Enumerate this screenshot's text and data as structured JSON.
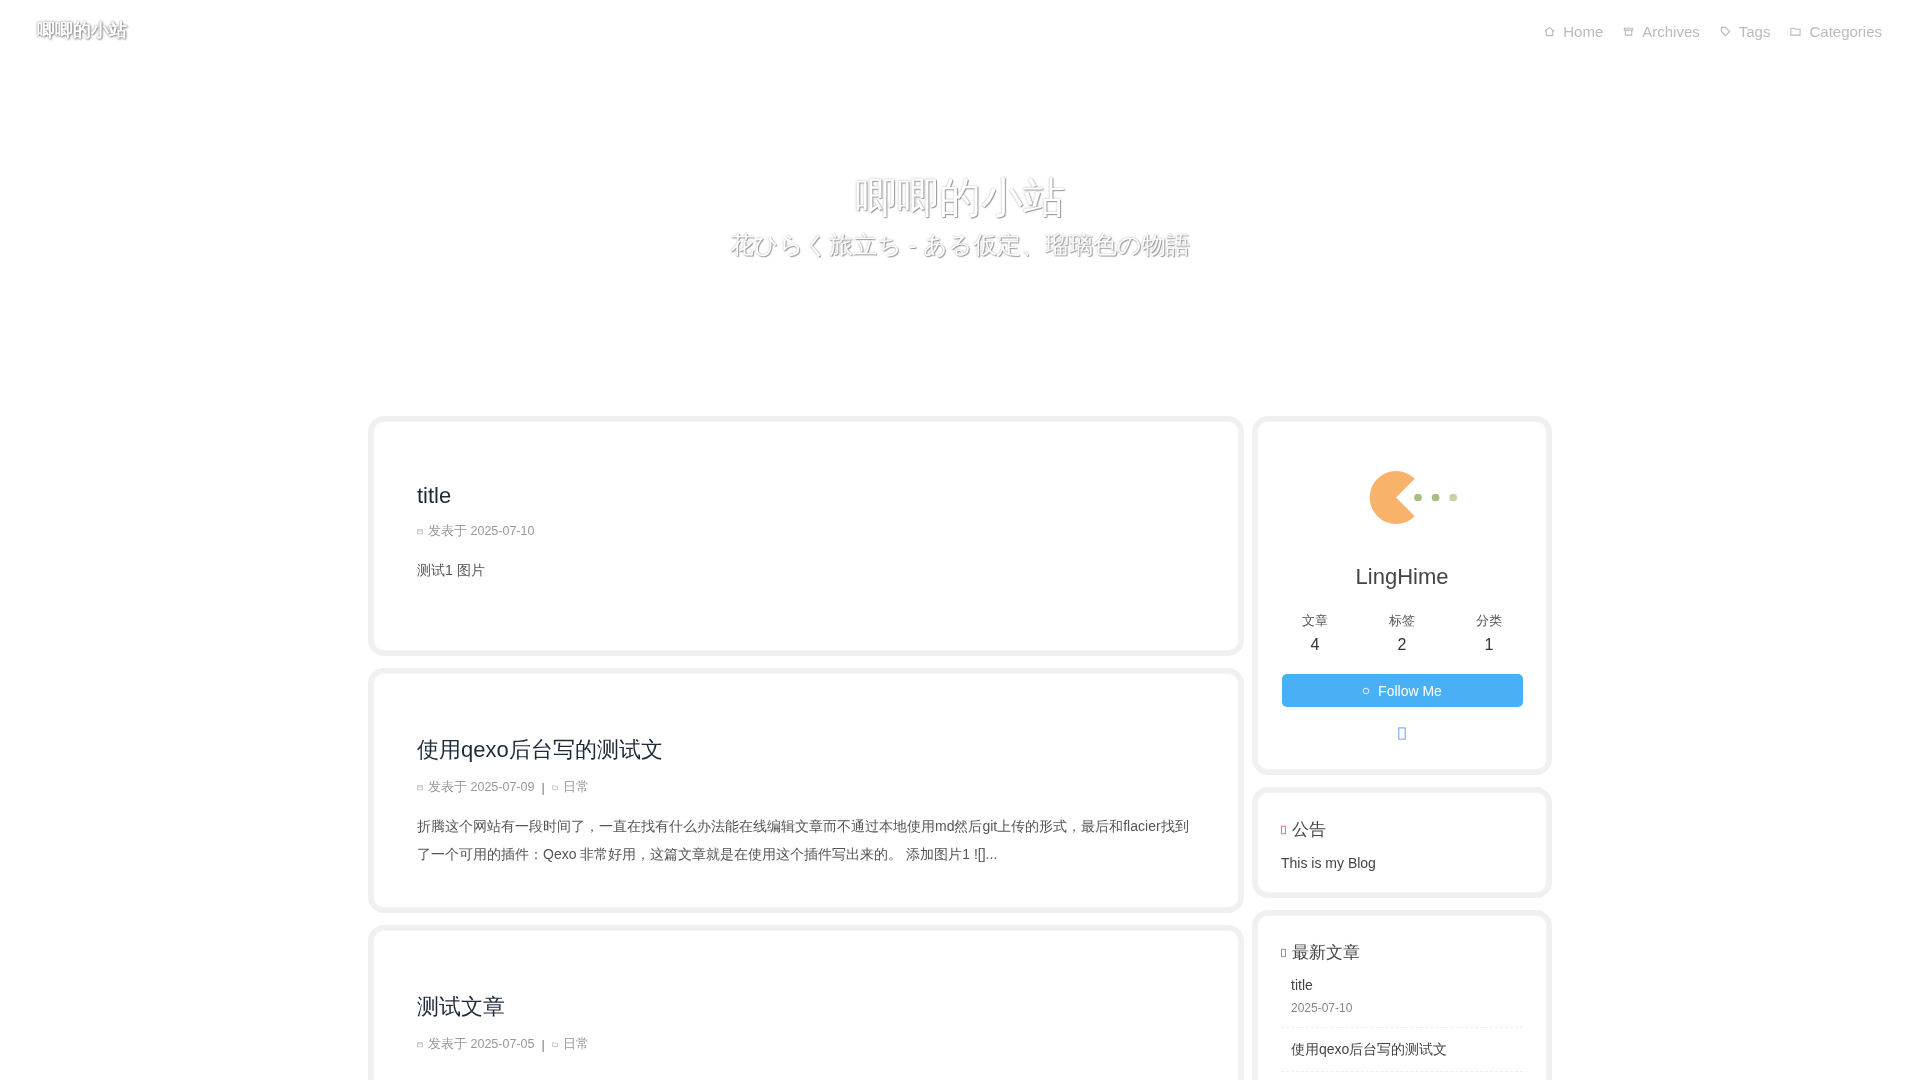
{
  "header": {
    "site_title": "唧唧的小站",
    "nav": [
      {
        "label": "Home"
      },
      {
        "label": "Archives"
      },
      {
        "label": "Tags"
      },
      {
        "label": "Categories"
      }
    ]
  },
  "hero": {
    "title": "唧唧的小站",
    "subtitle": "花ひらく旅立ち - ある仮定、瑠璃色の物語"
  },
  "posts": [
    {
      "title": "title",
      "date_label": "发表于 2025-07-10",
      "excerpt": "测试1 图片"
    },
    {
      "title": "使用qexo后台写的测试文",
      "date_label": "发表于 2025-07-09",
      "separator": "|",
      "category": "日常",
      "excerpt": "折腾这个网站有一段时间了，一直在找有什么办法能在线编辑文章而不通过本地使用md然后git上传的形式，最后和flacier找到了一个可用的插件：Qexo 非常好用，这篇文章就是在使用这个插件写出来的。 添加图片1 ![]..."
    },
    {
      "title": "测试文章",
      "date_label": "发表于 2025-07-05",
      "separator": "|",
      "category": "日常"
    }
  ],
  "profile": {
    "name": "LingHime",
    "stats": [
      {
        "label": "文章",
        "value": "4"
      },
      {
        "label": "标签",
        "value": "2"
      },
      {
        "label": "分类",
        "value": "1"
      }
    ],
    "follow_button": "Follow Me"
  },
  "announcement": {
    "heading": "公告",
    "text": "This is my Blog"
  },
  "recent_posts": {
    "heading": "最新文章",
    "items": [
      {
        "title": "title",
        "date": "2025-07-10"
      },
      {
        "title": "使用qexo后台写的测试文"
      }
    ]
  }
}
